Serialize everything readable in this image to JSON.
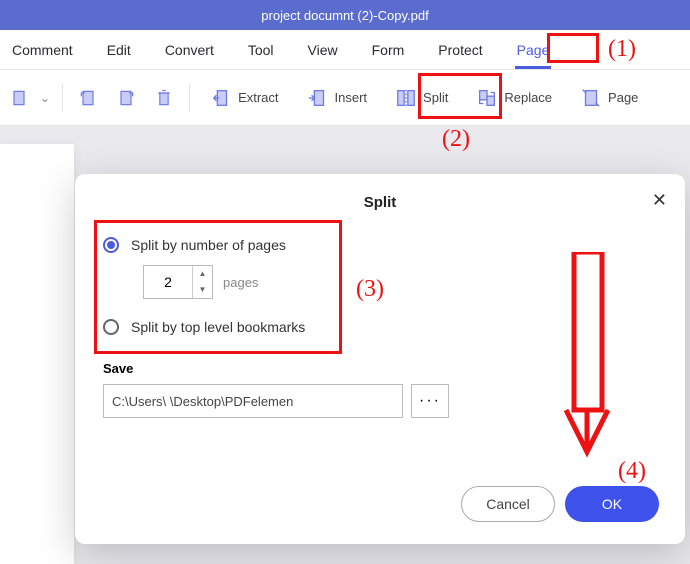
{
  "titlebar": {
    "title": "project documnt (2)-Copy.pdf"
  },
  "tabs": {
    "comment": "Comment",
    "edit": "Edit",
    "convert": "Convert",
    "tool": "Tool",
    "view": "View",
    "form": "Form",
    "protect": "Protect",
    "page": "Page"
  },
  "toolbar": {
    "extract": "Extract",
    "insert": "Insert",
    "split": "Split",
    "replace": "Replace",
    "page_label": "Page"
  },
  "dialog": {
    "title": "Split",
    "opt_pages": "Split by number of pages",
    "pages_value": "2",
    "pages_unit": "pages",
    "opt_bookmarks": "Split by top level bookmarks",
    "save_label": "Save",
    "path": "C:\\Users\\                    \\Desktop\\PDFelemen",
    "browse": "···",
    "cancel": "Cancel",
    "ok": "OK"
  },
  "annotations": {
    "n1": "(1)",
    "n2": "(2)",
    "n3": "(3)",
    "n4": "(4)"
  }
}
